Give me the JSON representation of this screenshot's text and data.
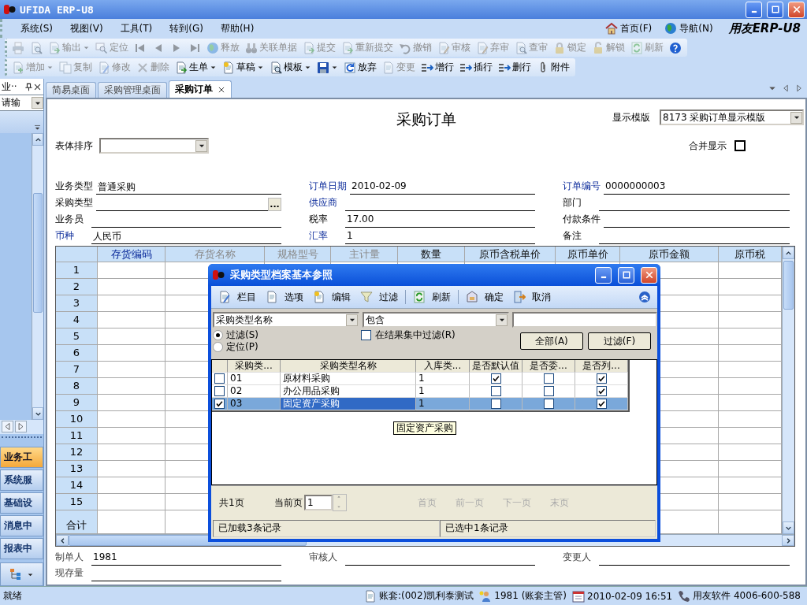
{
  "window": {
    "title": "UFIDA ERP-U8"
  },
  "menu": [
    "系统(S)",
    "视图(V)",
    "工具(T)",
    "转到(G)",
    "帮助(H)"
  ],
  "menu_right": [
    "首页(F)",
    "导航(N)"
  ],
  "brand": "用友ERP-U8",
  "toolbar_1": [
    {
      "kind": "icon",
      "disabled": true
    },
    {
      "kind": "icon",
      "disabled": true
    },
    {
      "kind": "dropdown",
      "label": "输出",
      "disabled": true
    },
    {
      "kind": "button",
      "label": "定位",
      "disabled": true
    },
    {
      "kind": "icon",
      "disabled": true
    },
    {
      "kind": "icon",
      "disabled": true
    },
    {
      "kind": "icon",
      "disabled": true
    },
    {
      "kind": "icon",
      "disabled": true
    },
    {
      "kind": "button",
      "label": "释放",
      "disabled": true
    },
    {
      "kind": "button",
      "label": "关联单据",
      "disabled": true
    },
    {
      "kind": "button",
      "label": "提交",
      "disabled": true
    },
    {
      "kind": "button",
      "label": "重新提交",
      "disabled": true
    },
    {
      "kind": "button",
      "label": "撤销",
      "disabled": true
    },
    {
      "kind": "button",
      "label": "审核",
      "disabled": true
    },
    {
      "kind": "button",
      "label": "弃审",
      "disabled": true
    },
    {
      "kind": "button",
      "label": "查审",
      "disabled": true
    },
    {
      "kind": "button",
      "label": "锁定",
      "disabled": true
    },
    {
      "kind": "button",
      "label": "解锁",
      "disabled": true
    },
    {
      "kind": "button",
      "label": "刷新",
      "disabled": true
    },
    {
      "kind": "icon",
      "disabled": false
    }
  ],
  "toolbar_2": [
    {
      "kind": "dropdown",
      "label": "增加",
      "disabled": true
    },
    {
      "kind": "button",
      "label": "复制",
      "disabled": true
    },
    {
      "kind": "button",
      "label": "修改",
      "disabled": true
    },
    {
      "kind": "button",
      "label": "删除",
      "disabled": true
    },
    {
      "kind": "dropdown",
      "label": "生单",
      "disabled": false
    },
    {
      "kind": "dropdown",
      "label": "草稿",
      "disabled": false
    },
    {
      "kind": "dropdown",
      "label": "模板",
      "disabled": false
    },
    {
      "kind": "icon-dropdown",
      "disabled": false
    },
    {
      "kind": "button",
      "label": "放弃",
      "disabled": false
    },
    {
      "kind": "button",
      "label": "变更",
      "disabled": true
    },
    {
      "kind": "button",
      "label": "增行",
      "disabled": false
    },
    {
      "kind": "button",
      "label": "插行",
      "disabled": false
    },
    {
      "kind": "button",
      "label": "删行",
      "disabled": false
    },
    {
      "kind": "button",
      "label": "附件",
      "disabled": false
    }
  ],
  "sidebar": {
    "title": "业··",
    "search": "请输",
    "nav": [
      {
        "label": "业务工",
        "selected": true
      },
      {
        "label": "系统服",
        "selected": false
      },
      {
        "label": "基础设",
        "selected": false
      },
      {
        "label": "消息中",
        "selected": false
      },
      {
        "label": "报表中",
        "selected": false
      }
    ]
  },
  "tabs": [
    {
      "label": "简易桌面",
      "selected": false,
      "closable": false
    },
    {
      "label": "采购管理桌面",
      "selected": false,
      "closable": false
    },
    {
      "label": "采购订单",
      "selected": true,
      "closable": true
    }
  ],
  "form": {
    "title": "采购订单",
    "template": {
      "label": "显示模版",
      "value": "8173 采购订单显示模版"
    },
    "sort": {
      "label": "表体排序"
    },
    "merge": {
      "label": "合并显示",
      "checked": false
    },
    "header_rows": [
      [
        {
          "label": "业务类型",
          "value": "普通采购",
          "required": false
        },
        {
          "label": "订单日期",
          "value": "2010-02-09",
          "required": true
        },
        {
          "label": "订单编号",
          "value": "0000000003",
          "required": true
        }
      ],
      [
        {
          "label": "采购类型",
          "required": false,
          "button": "..."
        },
        {
          "label": "供应商",
          "required": true
        },
        {
          "label": "部门",
          "required": false
        }
      ],
      [
        {
          "label": "业务员",
          "required": false
        },
        {
          "label": "税率",
          "value": "17.00",
          "required": false
        },
        {
          "label": "付款条件",
          "required": false
        }
      ],
      [
        {
          "label": "币种",
          "value": "人民币",
          "required": true
        },
        {
          "label": "汇率",
          "value": "1",
          "required": true
        },
        {
          "label": "备注",
          "required": false
        }
      ]
    ],
    "grid": {
      "columns": [
        {
          "label": "存货编码",
          "required": true,
          "disabled": false
        },
        {
          "label": "存货名称",
          "required": false,
          "disabled": true
        },
        {
          "label": "规格型号",
          "required": false,
          "disabled": true
        },
        {
          "label": "主计量",
          "required": false,
          "disabled": true
        },
        {
          "label": "数量",
          "required": false,
          "disabled": false
        },
        {
          "label": "原币含税单价",
          "required": false,
          "disabled": false
        },
        {
          "label": "原币单价",
          "required": false,
          "disabled": false
        },
        {
          "label": "原币金额",
          "required": false,
          "disabled": false
        },
        {
          "label": "原币税",
          "required": false,
          "disabled": false
        }
      ],
      "row_numbers": [
        "1",
        "2",
        "3",
        "4",
        "5",
        "6",
        "7",
        "8",
        "9",
        "10",
        "11",
        "12",
        "13",
        "14",
        "15"
      ],
      "total_label": "合计"
    },
    "footer_rows": [
      [
        {
          "label": "制单人",
          "value": "1981"
        },
        {
          "label": "审核人"
        },
        {
          "label": "变更人"
        }
      ],
      [
        {
          "label": "现存量"
        }
      ]
    ]
  },
  "dialog": {
    "title": "采购类型档案基本参照",
    "toolbar": [
      "栏目",
      "选项",
      "编辑",
      "过滤",
      "刷新",
      "确定",
      "取消"
    ],
    "filter": {
      "field": "采购类型名称",
      "operator": "包含"
    },
    "radios": [
      {
        "label": "过滤(S)",
        "selected": true
      },
      {
        "label": "定位(P)",
        "selected": false
      }
    ],
    "checkbox": {
      "label": "在结果集中过滤(R)",
      "checked": false
    },
    "buttons": [
      "全部(A)",
      "过滤(F)"
    ],
    "table": {
      "columns": [
        "采购类...",
        "采购类型名称",
        "入库类...",
        "是否默认值",
        "是否委...",
        "是否列..."
      ],
      "rows": [
        {
          "checked": false,
          "selected": false,
          "cells": [
            "01",
            "原材料采购",
            "1"
          ],
          "flags": [
            true,
            false,
            true
          ]
        },
        {
          "checked": false,
          "selected": false,
          "cells": [
            "02",
            "办公用品采购",
            "1"
          ],
          "flags": [
            false,
            false,
            true
          ]
        },
        {
          "checked": true,
          "selected": true,
          "cells": [
            "03",
            "固定资产采购",
            "1"
          ],
          "flags": [
            false,
            false,
            true
          ]
        }
      ]
    },
    "tooltip": "固定资产采购",
    "pager": {
      "total": "共1页",
      "current_label": "当前页",
      "current": "1",
      "links": [
        {
          "label": "首页",
          "disabled": true
        },
        {
          "label": "前一页",
          "disabled": true
        },
        {
          "label": "下一页",
          "disabled": true
        },
        {
          "label": "末页",
          "disabled": true
        }
      ]
    },
    "status": [
      "已加载3条记录",
      "已选中1条记录"
    ]
  },
  "status_bar": {
    "text": "就绪",
    "items": [
      "账套:(002)凯利泰测试",
      "1981 (账套主管)",
      "2010-02-09  16:51",
      "用友软件  4006-600-588"
    ]
  }
}
